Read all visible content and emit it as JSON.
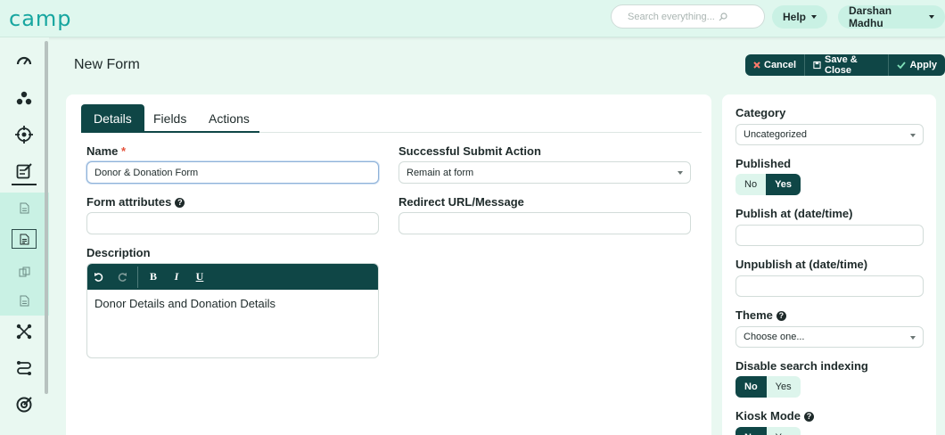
{
  "app": {
    "logo": "camp"
  },
  "topbar": {
    "search_placeholder": "Search everything...",
    "help_label": "Help",
    "user_label": "Darshan Madhu"
  },
  "page": {
    "title": "New Form"
  },
  "actions": {
    "cancel": "Cancel",
    "save_close": "Save & Close",
    "apply": "Apply"
  },
  "tabs": [
    {
      "label": "Details"
    },
    {
      "label": "Fields"
    },
    {
      "label": "Actions"
    }
  ],
  "form": {
    "name_label": "Name",
    "name_required": "*",
    "name_value": "Donor & Donation Form",
    "attributes_label": "Form attributes",
    "attributes_value": "",
    "description_label": "Description",
    "description_value": "Donor Details and Donation Details",
    "submit_action_label": "Successful Submit Action",
    "submit_action_value": "Remain at form",
    "redirect_label": "Redirect URL/Message",
    "redirect_value": ""
  },
  "editor_toolbar": {
    "bold": "B",
    "italic": "I",
    "underline": "U"
  },
  "side": {
    "category_label": "Category",
    "category_value": "Uncategorized",
    "published_label": "Published",
    "published_no": "No",
    "published_yes": "Yes",
    "published_selected": "Yes",
    "publish_at_label": "Publish at (date/time)",
    "unpublish_at_label": "Unpublish at (date/time)",
    "theme_label": "Theme",
    "theme_value": "Choose one...",
    "disable_index_label": "Disable search indexing",
    "disable_index_no": "No",
    "disable_index_yes": "Yes",
    "disable_index_selected": "No",
    "kiosk_label": "Kiosk Mode",
    "kiosk_no": "No",
    "kiosk_yes": "Yes"
  },
  "colors": {
    "accent_dark": "#0f4646",
    "brand": "#17a6a0",
    "background": "#e9f8f1",
    "required": "#e4523b"
  }
}
